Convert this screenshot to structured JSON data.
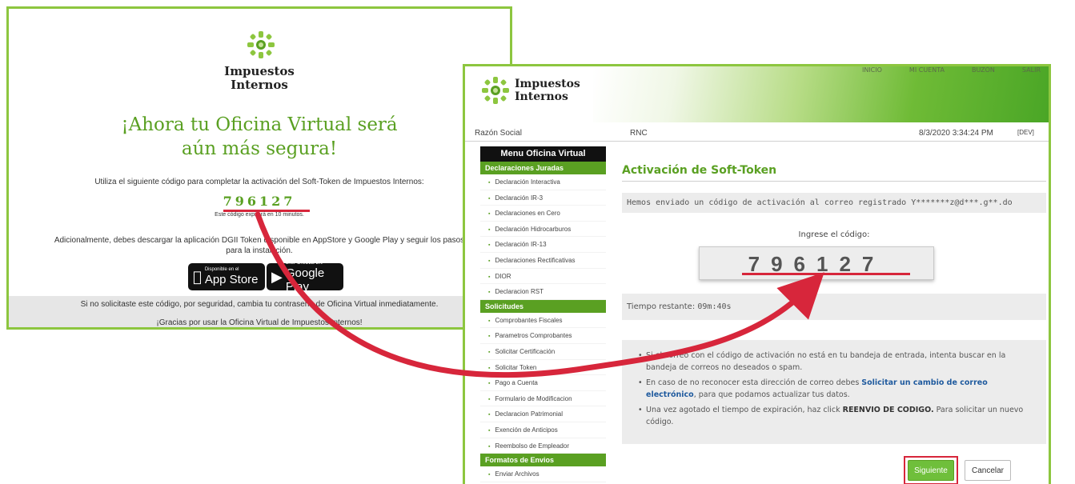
{
  "email": {
    "brand_line1": "Impuestos",
    "brand_line2": "Internos",
    "heading_line1": "¡Ahora tu Oficina Virtual será",
    "heading_line2": "aún más segura!",
    "intro": "Utiliza el siguiente código para completar la activación del Soft-Token de Impuestos Internos:",
    "code": "796127",
    "expiry_note": "Este código expirará en 10 minutos.",
    "download_note_line1": "Adicionalmente, debes descargar la aplicación DGII Token disponible en AppStore y Google Play y seguir los pasos",
    "download_note_line2": "para la instalación.",
    "appstore_small": "Disponible en el",
    "appstore_big": "App Store",
    "googleplay_small": "DISPONIBLE EN",
    "googleplay_big": "Google Play",
    "security_note": "Si no solicitaste este código, por seguridad, cambia tu contraseña de Oficina Virtual inmediatamente.",
    "thanks": "¡Gracias por usar la Oficina Virtual de Impuestos Internos!"
  },
  "portal": {
    "brand_line1": "Impuestos",
    "brand_line2": "Internos",
    "nav": [
      "INICIO",
      "MI CUENTA",
      "BUZÓN",
      "SALIR"
    ],
    "info": {
      "razon_social": "Razón Social",
      "rnc": "RNC",
      "datetime": "8/3/2020 3:34:24 PM",
      "env": "[DEV]"
    },
    "menu_title": "Menu Oficina Virtual",
    "sections": [
      {
        "title": "Declaraciones Juradas",
        "items": [
          "Declaración Interactiva",
          "Declaración IR-3",
          "Declaraciones en Cero",
          "Declaración Hidrocarburos",
          "Declaración IR-13",
          "Declaraciones Rectificativas",
          "DIOR",
          "Declaracion RST"
        ]
      },
      {
        "title": "Solicitudes",
        "items": [
          "Comprobantes Fiscales",
          "Parametros Comprobantes",
          "Solicitar Certificación",
          "Solicitar Token",
          "Pago a Cuenta",
          "Formulario de Modificacion",
          "Declaracion Patrimonial",
          "Exención de Anticipos",
          "Reembolso de Empleador"
        ]
      },
      {
        "title": "Formatos de Envios",
        "items": [
          "Enviar Archivos"
        ]
      }
    ],
    "page_title": "Activación de Soft-Token",
    "sent_message": "Hemos enviado un código de activación al correo registrado Y*******z@d***.g**.do",
    "code_label": "Ingrese el código:",
    "code_value": "796127",
    "time_label": "Tiempo restante: ",
    "time_value": "09m:40s",
    "note1": "Si el correo con el código de activación no está en tu bandeja de entrada, intenta buscar en la bandeja de correos no deseados o spam.",
    "note2_pre": "En caso de no reconocer esta dirección de correo debes ",
    "note2_link": "Solicitar un cambio de correo electrónico",
    "note2_post": ", para que podamos actualizar tus datos.",
    "note3_pre": "Una vez agotado el tiempo de expiración, haz click ",
    "note3_strong": "REENVIO DE CODIGO.",
    "note3_post": " Para solicitar un nuevo código.",
    "next_label": "Siguiente",
    "cancel_label": "Cancelar"
  },
  "colors": {
    "brand_green": "#5aa022",
    "border_green": "#8dc63f",
    "highlight_red": "#d7263b",
    "link_blue": "#1f5a9e"
  }
}
